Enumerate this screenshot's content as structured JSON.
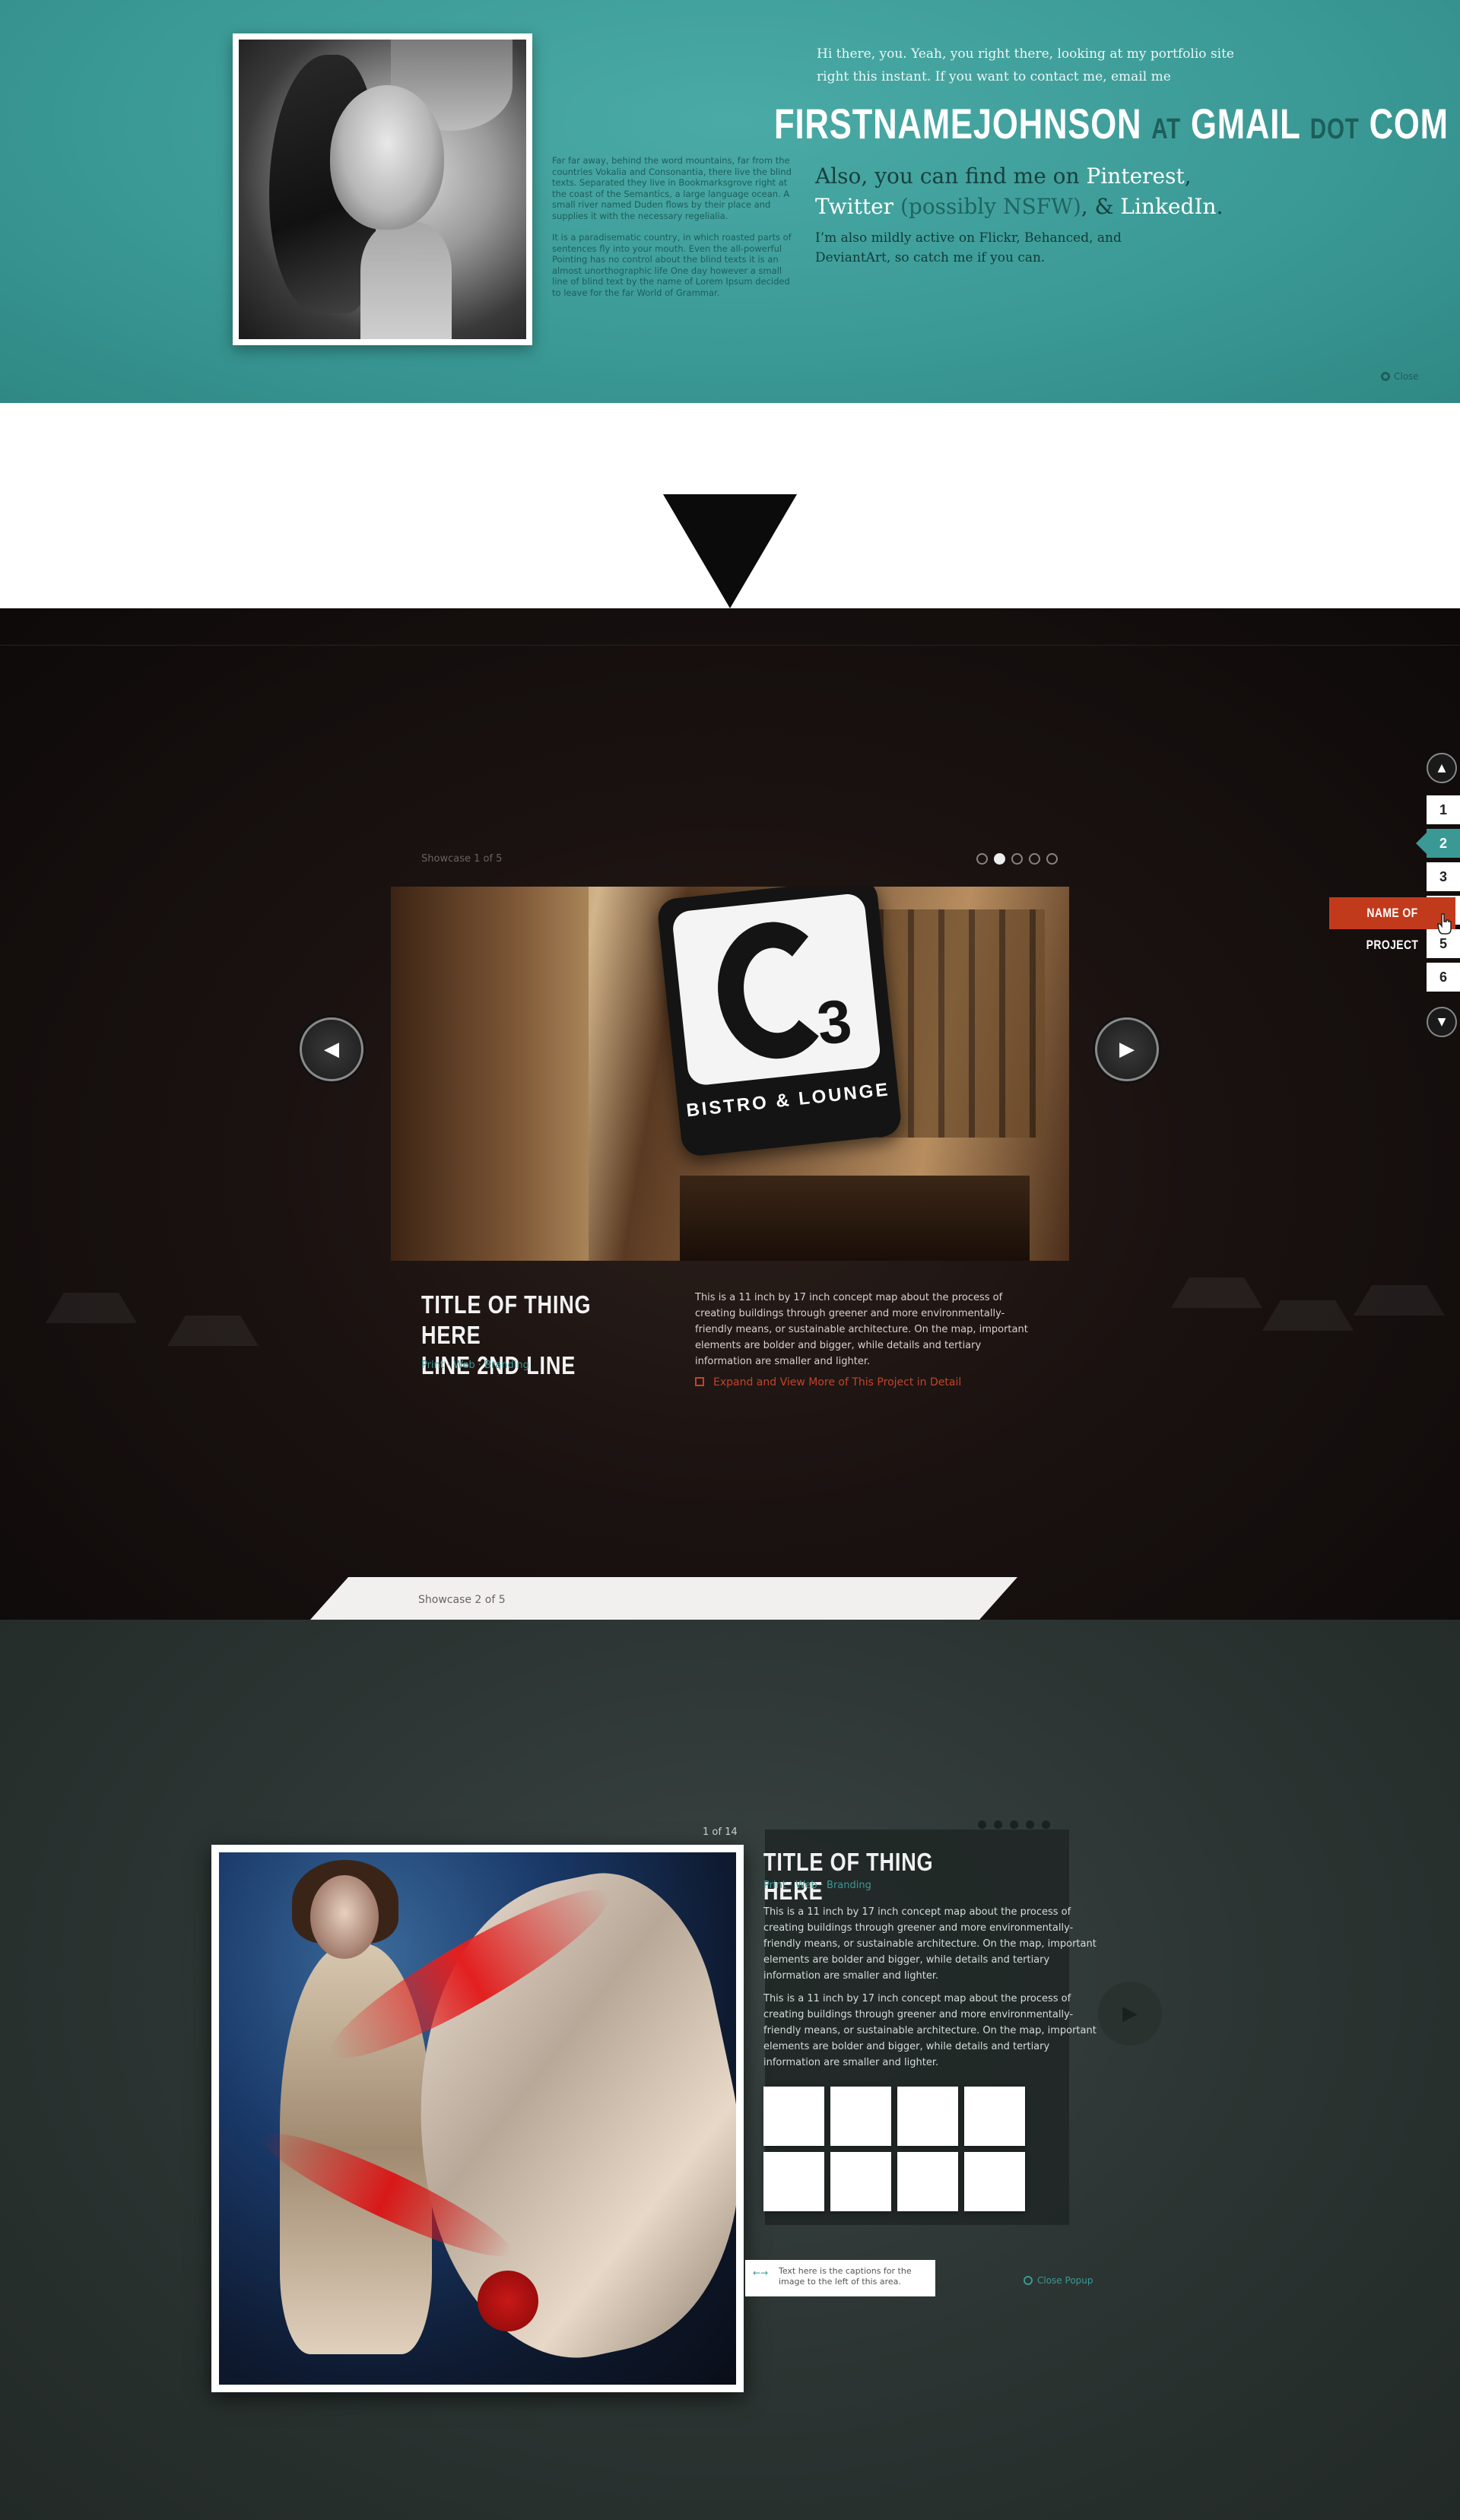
{
  "contact": {
    "blind_text_1": "Far far away, behind the word mountains, far from the countries Vokalia and Consonantia, there live the blind texts. Separated they live in Bookmarksgrove right at the coast of the Semantics, a large language ocean. A small river named Duden flows by their place and supplies it with the necessary regelialia.",
    "blind_text_2": "It is a paradisematic country, in which roasted parts of sentences fly into your mouth. Even the all-powerful Pointing has no control about the blind texts it is an almost unorthographic life One day however a small line of blind text by the name of Lorem Ipsum decided to leave for the far World of Grammar.",
    "hi_text": "Hi there, you. Yeah, you right there, looking at my portfolio site right this instant. If you want to contact me, email me",
    "email": {
      "name": "FIRSTNAMEJOHNSON",
      "at": "AT",
      "domain": "GMAIL",
      "dot": "DOT",
      "tld": "COM"
    },
    "find_me": {
      "prefix": "Also, you can find me on",
      "pinterest": "Pinterest",
      "comma1": ",",
      "twitter": "Twitter",
      "nsfw": "(possibly NSFW)",
      "amp": ", &",
      "linkedin": "LinkedIn",
      "period": "."
    },
    "also_active": "I’m also mildly active on Flickr, Behanced, and DeviantArt, so catch me if you can.",
    "close_label": "Close"
  },
  "showcase1": {
    "count_label": "Showcase 1 of 5",
    "dots": [
      false,
      true,
      false,
      false,
      false
    ],
    "sign_text": "BISTRO & LOUNGE",
    "sign_number": "3",
    "prev_icon": "◀",
    "next_icon": "▶",
    "title_line1": "TITLE OF THING HERE",
    "title_line2": "LINE 2ND LINE",
    "tags": "Print · Web · Branding",
    "description": "This is a 11 inch by 17 inch concept map about the process of creating buildings through greener and more environmentally-friendly means, or sustainable architecture. On the map, important elements are bolder and bigger, while details and tertiary information are smaller and lighter.",
    "expand_link": "Expand and View More of This Project in Detail"
  },
  "pager": {
    "up_icon": "▲",
    "down_icon": "▼",
    "numbers": [
      "1",
      "2",
      "3",
      "",
      "5",
      "6"
    ],
    "active_index": 1,
    "tooltip": "NAME OF PROJECT"
  },
  "showcase2": {
    "tab_label": "Showcase 2 of 5",
    "count_label": "1 of 14",
    "title": "TITLE OF THING HERE",
    "tags": "Print · Web · Branding",
    "desc1": "This is a 11 inch by 17 inch concept map about the process of creating buildings through greener and more environmentally-friendly means, or sustainable architecture. On the map, important elements are bolder and bigger, while details and tertiary information are smaller and lighter.",
    "desc2": "This is a 11 inch by 17 inch concept map about the process of creating buildings through greener and more environmentally-friendly means, or sustainable architecture. On the map, important elements are bolder and bigger, while details and tertiary information are smaller and lighter.",
    "caption_arrows": "←→",
    "caption": "Text here is the captions for the image to the left of this area.",
    "close_popup": "Close Popup",
    "next_icon": "▶"
  },
  "colors": {
    "teal": "#3a9995",
    "accent_red": "#c23a1c",
    "dark_bg": "#0e0a0a"
  }
}
